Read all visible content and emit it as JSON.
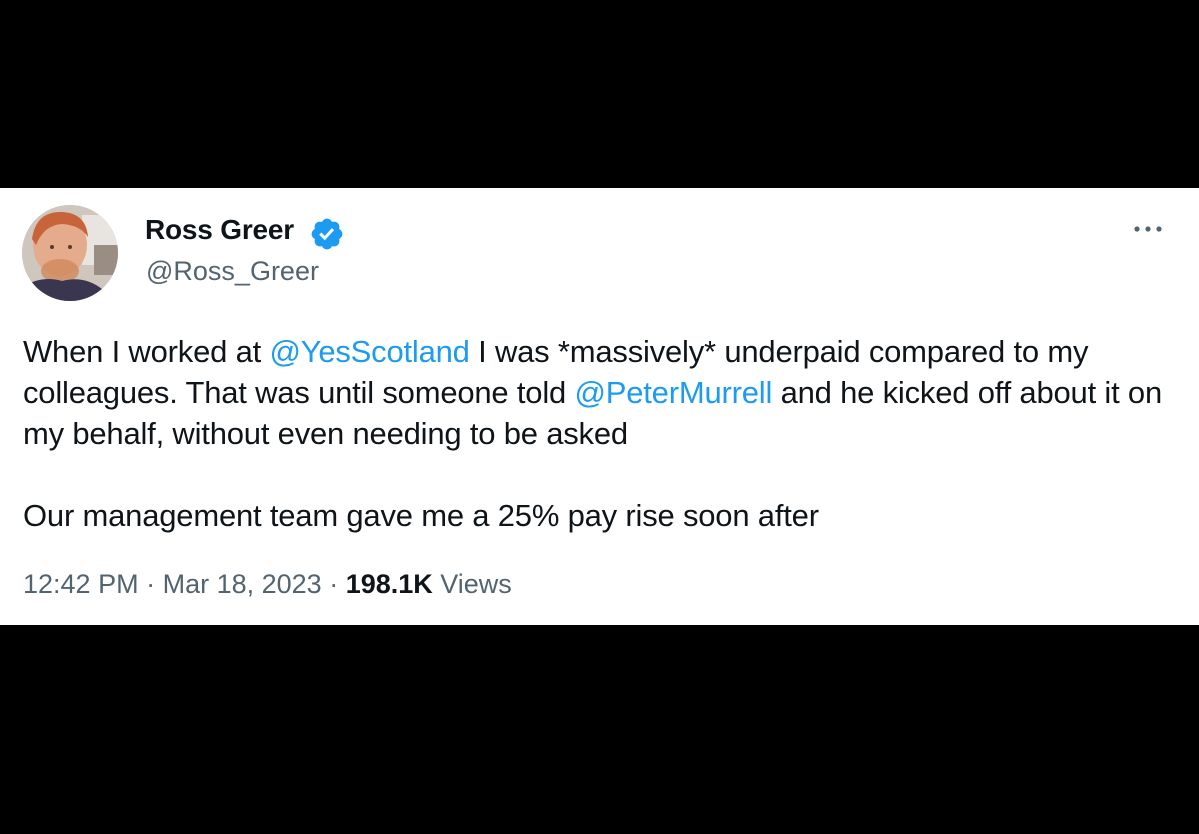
{
  "author": {
    "display_name": "Ross Greer",
    "handle": "@Ross_Greer",
    "verified": true,
    "avatar_icon": "profile-photo"
  },
  "tweet": {
    "paragraph1": {
      "text_before_mention1": "When I worked at ",
      "mention1": "@YesScotland",
      "text_between_mentions": " I was *massively* underpaid compared to my colleagues. That was until someone told ",
      "mention2": "@PeterMurrell",
      "text_after_mention2": " and he kicked off about it on my behalf, without even needing to be asked"
    },
    "paragraph2": "Our management team gave me a 25% pay rise soon after"
  },
  "meta": {
    "time": "12:42 PM",
    "separator1": " · ",
    "date": "Mar 18, 2023",
    "separator2": " · ",
    "views_count": "198.1K",
    "views_label": " Views"
  },
  "colors": {
    "background": "#000000",
    "card": "#ffffff",
    "text": "#0f1419",
    "secondary_text": "#536471",
    "link": "#1d9bf0",
    "verified": "#1d9bf0"
  },
  "icons": {
    "verified": "verified-badge-icon",
    "more": "more-options-icon"
  }
}
